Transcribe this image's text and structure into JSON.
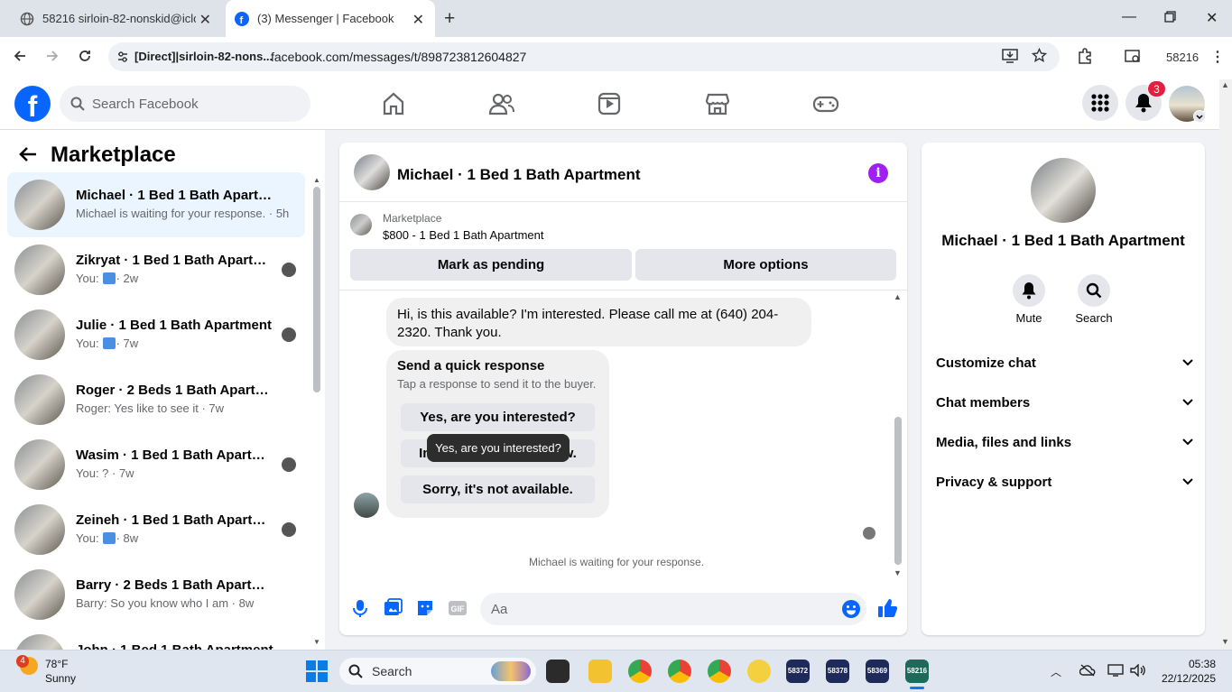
{
  "browser": {
    "tabs": [
      {
        "title": "58216 sirloin-82-nonskid@iclou"
      },
      {
        "title": "(3) Messenger | Facebook"
      }
    ],
    "site_chip": "[Direct]|sirloin-82-nons...",
    "url": "facebook.com/messages/t/898723812604827",
    "profile_label": "58216"
  },
  "fb_header": {
    "search_placeholder": "Search Facebook",
    "notification_count": "3"
  },
  "left_pane": {
    "title": "Marketplace",
    "conversations": [
      {
        "name": "Michael · 1 Bed 1 Bath Apartment",
        "snippet": "Michael is waiting for your response. · 5h",
        "you_like": false,
        "time": ""
      },
      {
        "name": "Zikryat · 1 Bed 1 Bath Apartme...",
        "snippet": "You:",
        "you_like": true,
        "time": "· 2w"
      },
      {
        "name": "Julie · 1 Bed 1 Bath Apartment",
        "snippet": "You:",
        "you_like": true,
        "time": "· 7w"
      },
      {
        "name": "Roger · 2 Beds 1 Bath Apartment",
        "snippet": "Roger: Yes like to see it · 7w",
        "you_like": false,
        "time": ""
      },
      {
        "name": "Wasim · 1 Bed 1 Bath Apartment",
        "snippet": "You: ? · 7w",
        "you_like": false,
        "time": ""
      },
      {
        "name": "Zeineh · 1 Bed 1 Bath Apartme...",
        "snippet": "You:",
        "you_like": true,
        "time": "· 8w"
      },
      {
        "name": "Barry · 2 Beds 1 Bath Apartment",
        "snippet": "Barry: So you know who I am · 8w",
        "you_like": false,
        "time": ""
      },
      {
        "name": "John · 1 Bed 1 Bath Apartment",
        "snippet": "",
        "you_like": false,
        "time": ""
      }
    ]
  },
  "chat": {
    "title": "Michael · 1 Bed 1 Bath Apartment",
    "marketplace_label": "Marketplace",
    "listing": "$800 - 1 Bed 1 Bath Apartment",
    "mark_pending": "Mark as pending",
    "more_options": "More options",
    "message": "Hi, is this available? I'm interested. Please call me at (640) 204-2320. Thank you.",
    "quick_title": "Send a quick response",
    "quick_sub": "Tap a response to send it to the buyer.",
    "quick_responses": [
      "Yes, are you interested?",
      "In talks. I'll let you know.",
      "Sorry, it's not available."
    ],
    "tooltip": "Yes, are you interested?",
    "waiting": "Michael is waiting for your response.",
    "composer_placeholder": "Aa"
  },
  "right_pane": {
    "name": "Michael · 1 Bed 1 Bath Apartment",
    "actions": [
      "Mute",
      "Search"
    ],
    "sections": [
      "Customize chat",
      "Chat members",
      "Media, files and links",
      "Privacy & support"
    ]
  },
  "taskbar": {
    "weather_badge": "4",
    "temp": "78°F",
    "condition": "Sunny",
    "search_label": "Search",
    "pinned_labels": [
      "58372",
      "58378",
      "58369",
      "58216"
    ],
    "time": "05:38",
    "date": "22/12/2025"
  }
}
